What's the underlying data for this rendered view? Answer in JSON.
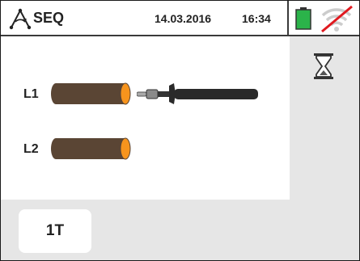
{
  "header": {
    "mode_label": "SEQ",
    "date": "14.03.2016",
    "time": "16:34",
    "battery_color": "#2bb34a",
    "wireless_status": "disconnected"
  },
  "leads": [
    {
      "label": "L1",
      "connected_tip": true
    },
    {
      "label": "L2",
      "connected_tip": false
    }
  ],
  "side": {
    "status_icon": "hourglass-icon"
  },
  "bottom": {
    "key_label": "1T"
  },
  "colors": {
    "probe_body": "#5a4534",
    "probe_end": "#f7941d",
    "panel_bg": "#e6e6e6",
    "no_signal_slash": "#e0191f"
  }
}
